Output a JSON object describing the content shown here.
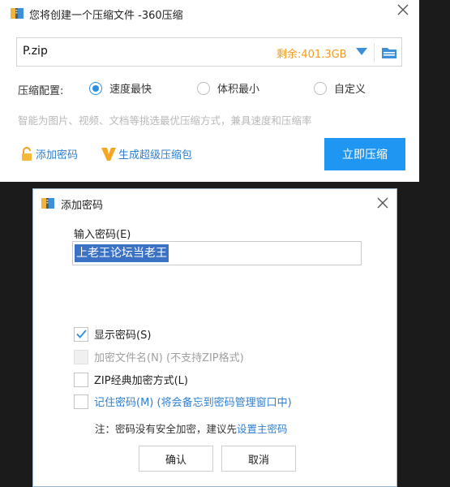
{
  "main_window": {
    "title": "您将创建一个压缩文件 -360压缩",
    "path_value": "P.zip",
    "free_space": "剩余:401.3GB",
    "config_label": "压缩配置:",
    "options": [
      {
        "label": "速度最快",
        "selected": true
      },
      {
        "label": "体积最小",
        "selected": false
      },
      {
        "label": "自定义",
        "selected": false
      }
    ],
    "hint": "智能为图片、视频、文档等挑选最优压缩方式，兼具速度和压缩率",
    "add_password": "添加密码",
    "super_package": "生成超级压缩包",
    "compress_now": "立即压缩"
  },
  "password_dialog": {
    "title": "添加密码",
    "input_label": "输入密码(E)",
    "password_value": "上老王论坛当老王",
    "checkboxes": [
      {
        "label": "显示密码(S)",
        "checked": true,
        "enabled": true
      },
      {
        "label": "加密文件名(N) (不支持ZIP格式)",
        "checked": false,
        "enabled": false
      },
      {
        "label": "ZIP经典加密方式(L)",
        "checked": false,
        "enabled": true
      },
      {
        "label_link": "记住密码(M)",
        "label_rest": " (将会备忘到密码管理窗口中)",
        "checked": false,
        "enabled": true
      }
    ],
    "note_prefix": "注：密码没有安全加密，建议先",
    "note_link": "设置主密码",
    "ok": "确认",
    "cancel": "取消"
  },
  "colors": {
    "accent": "#1e96f2",
    "link": "#2d7fd1",
    "free_space": "#f09a1e",
    "selection": "#3c72c5"
  }
}
